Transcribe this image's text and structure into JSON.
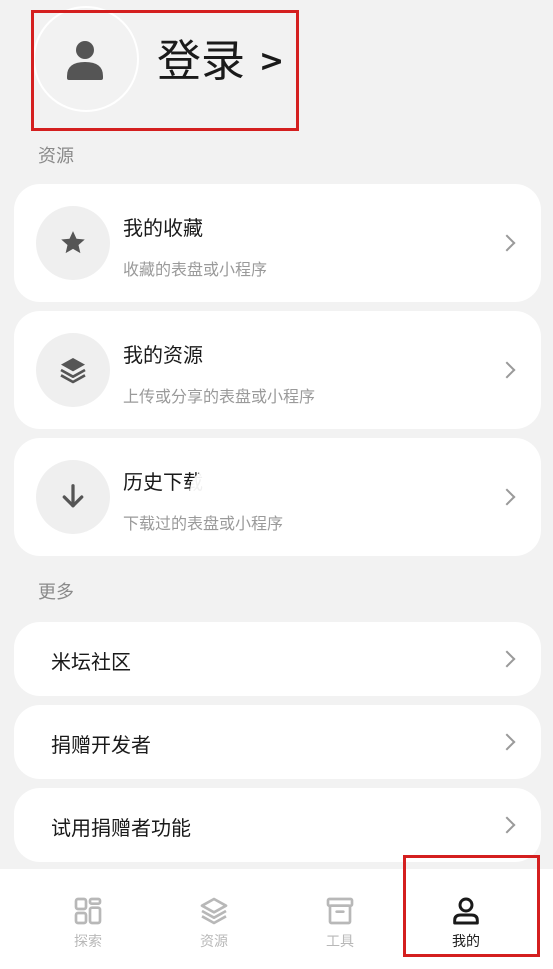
{
  "header": {
    "login_label": "登录",
    "login_arrow": ">"
  },
  "sections": {
    "resources": "资源",
    "more": "更多"
  },
  "resource_cards": [
    {
      "title": "我的收藏",
      "subtitle": "收藏的表盘或小程序",
      "icon": "star-icon"
    },
    {
      "title": "我的资源",
      "subtitle": "上传或分享的表盘或小程序",
      "icon": "layers-icon"
    },
    {
      "title": "历史下载",
      "subtitle": "下载过的表盘或小程序",
      "icon": "download-icon"
    }
  ],
  "more_items": [
    {
      "label": "米坛社区"
    },
    {
      "label": "捐赠开发者"
    },
    {
      "label": "试用捐赠者功能"
    }
  ],
  "tabbar": {
    "tabs": [
      {
        "label": "探索",
        "icon": "grid-icon",
        "active": false
      },
      {
        "label": "资源",
        "icon": "layers-icon",
        "active": false
      },
      {
        "label": "工具",
        "icon": "archive-icon",
        "active": false
      },
      {
        "label": "我的",
        "icon": "person-icon",
        "active": true
      }
    ]
  },
  "colors": {
    "background": "#f2f2f2",
    "card": "#ffffff",
    "highlight": "#d41f1f",
    "muted": "#9a9a9a",
    "icon": "#555555"
  }
}
